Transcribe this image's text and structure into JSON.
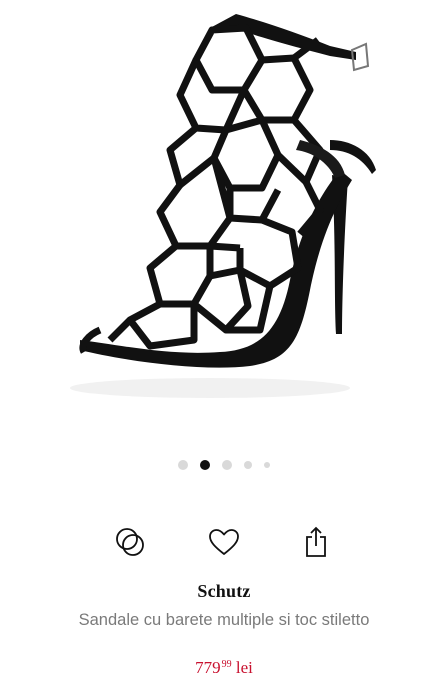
{
  "product": {
    "brand": "Schutz",
    "name": "Sandale cu barete multiple si toc stiletto",
    "price": {
      "integer": "779",
      "decimals": "99",
      "currency": "lei",
      "color": "#c8102e"
    }
  },
  "gallery": {
    "image_count": 5,
    "active_index": 1
  },
  "actions": {
    "compare_icon": "compare-circles-icon",
    "wishlist_icon": "heart-icon",
    "share_icon": "share-icon"
  }
}
